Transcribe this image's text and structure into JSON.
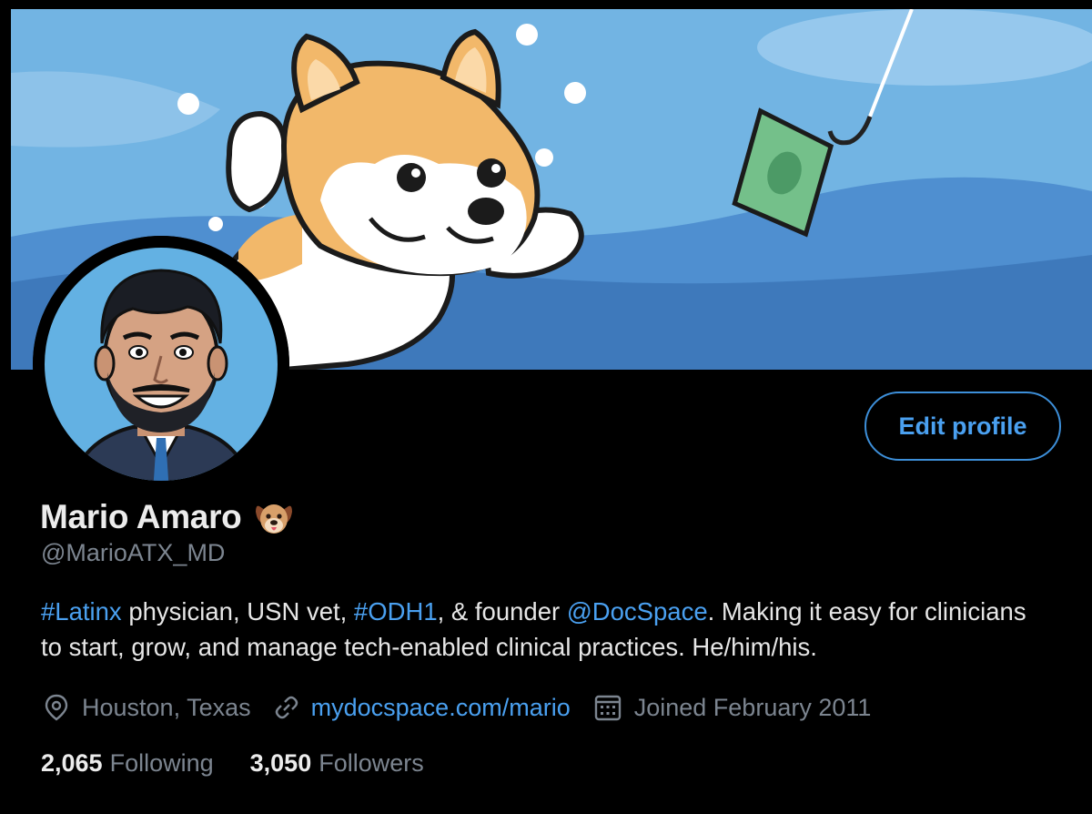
{
  "profile": {
    "name": "Mario Amaro",
    "handle": "@MarioATX_MD",
    "name_emoji": "dog-face-emoji",
    "edit_button_label": "Edit profile"
  },
  "bio": {
    "hashtag_latinx": "#Latinx",
    "text_1": " physician, USN vet, ",
    "hashtag_odh1": "#ODH1",
    "text_2": ", & founder ",
    "mention_docspace": "@DocSpace",
    "text_3": ". Making it easy for clinicians to start, grow, and manage tech-enabled clinical practices. He/him/his."
  },
  "meta": {
    "location": "Houston, Texas",
    "location_icon": "location-pin-icon",
    "website": "mydocspace.com/mario",
    "website_icon": "link-icon",
    "joined": "Joined February 2011",
    "joined_icon": "calendar-icon"
  },
  "stats": {
    "following_count": "2,065",
    "following_label": "Following",
    "followers_count": "3,050",
    "followers_label": "Followers"
  },
  "colors": {
    "background": "#000000",
    "accent_link": "#4aa0f0",
    "secondary_text": "#7c8590",
    "banner_sky": "#72b4e3",
    "banner_water": "#3e79bb"
  }
}
